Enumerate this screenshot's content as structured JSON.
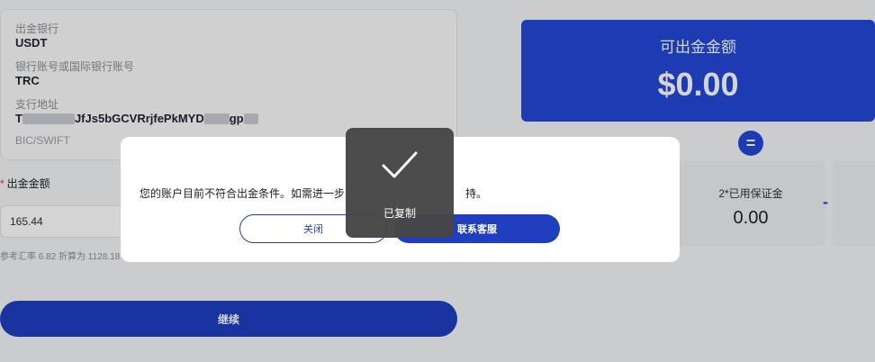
{
  "bank": {
    "bank_label": "出金银行",
    "bank_value": "USDT",
    "account_label": "银行账号或国际银行账号",
    "account_value": "TRC",
    "branch_label": "支行地址",
    "address_prefix": "T",
    "address_visible": "JfJs5bGCVRrjfePkMYD",
    "address_suffix": "gp",
    "bic_label": "BIC/SWIFT"
  },
  "amount": {
    "label": "出金金额",
    "value": "165.44",
    "rate_note": "参考汇率 6.82 折算为 1128.18 人民币"
  },
  "continue_label": "继续",
  "available": {
    "title": "可出金金额",
    "value": "$0.00"
  },
  "equals_symbol": "=",
  "margin": {
    "title": "2*已用保证金",
    "value": "0.00"
  },
  "minus_symbol": "-",
  "modal": {
    "message_left": "您的账户目前不符合出金条件。如需进一步",
    "message_right": "持。",
    "close_label": "关闭",
    "contact_label": "联系客服"
  },
  "toast": {
    "icon": "check-icon",
    "text": "已复制"
  },
  "colors": {
    "primary": "#1f3fbf",
    "accent_card": "#2348d8",
    "toast_bg": "#464646"
  }
}
